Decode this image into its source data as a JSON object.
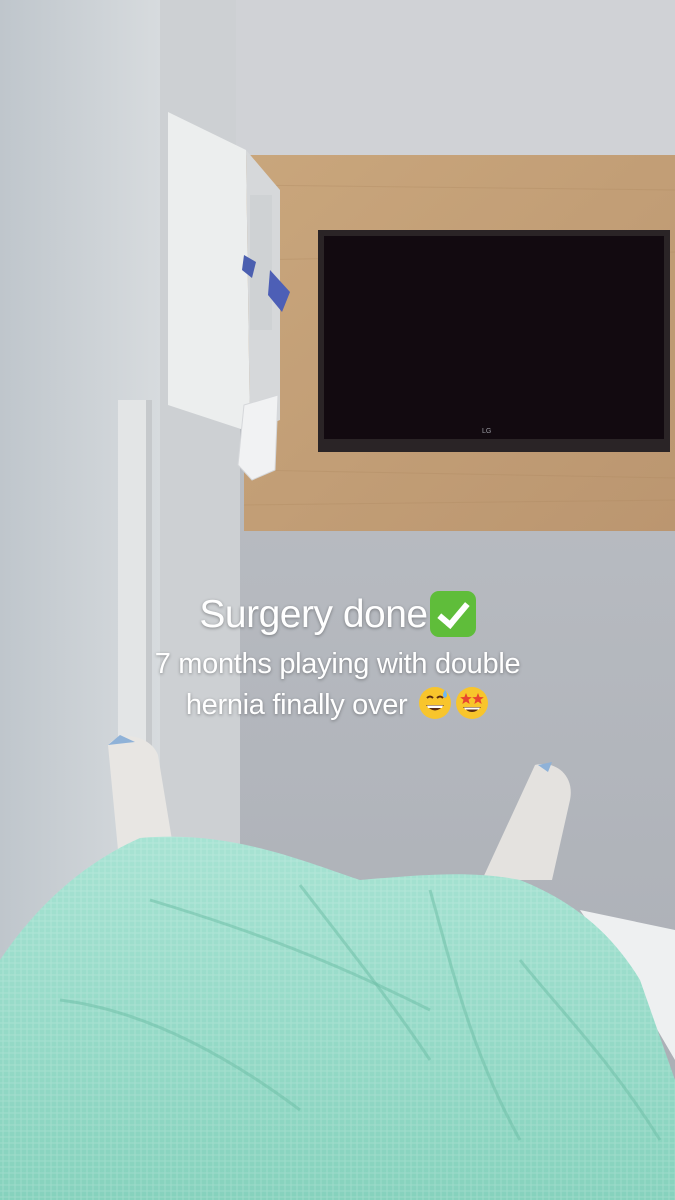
{
  "story": {
    "caption": {
      "line1": "Surgery done",
      "line1_emoji": "white-heavy-check-mark",
      "line2": "7 months playing with double",
      "line3": "hernia finally over",
      "line3_emojis": [
        "grinning-face-with-sweat",
        "star-struck-face"
      ]
    },
    "tv": {
      "brand": "LG"
    }
  },
  "colors": {
    "wall": "#b9bdc3",
    "wood_panel": "#c9a67d",
    "tv_screen": "#120a10",
    "blanket": "#8fd8c4",
    "caption_text": "#ffffff",
    "check_green": "#5fbd3a"
  }
}
